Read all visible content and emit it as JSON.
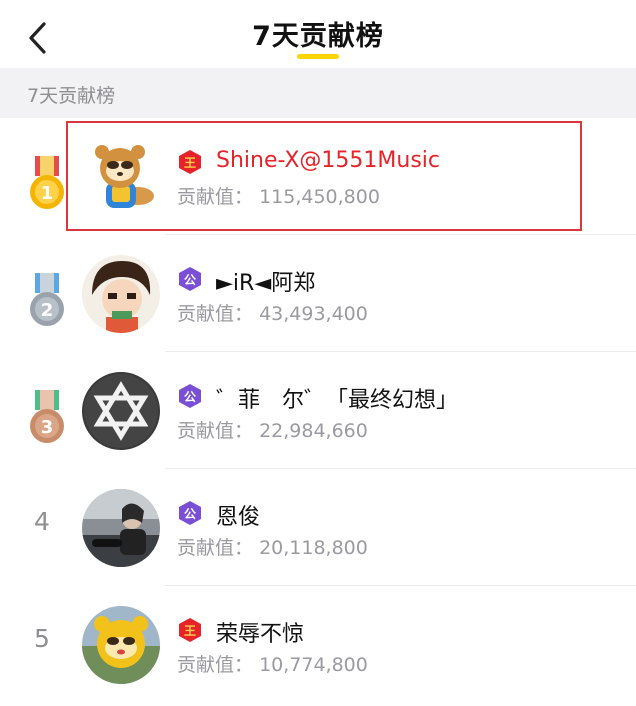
{
  "header": {
    "title": "7天贡献榜",
    "back_icon": "chevron-left-icon",
    "accent_color": "#ffd400"
  },
  "section": {
    "label": "7天贡献榜"
  },
  "list": {
    "value_prefix": "贡献值：",
    "items": [
      {
        "rank": "1",
        "badge": "王",
        "badge_color": "#e8222a",
        "name": "Shine-X@1551Music",
        "value": "115,450,800",
        "highlighted": true
      },
      {
        "rank": "2",
        "badge": "公",
        "badge_color": "#7a4fd6",
        "name": "►iR◄阿郑",
        "value": "43,493,400",
        "highlighted": false
      },
      {
        "rank": "3",
        "badge": "公",
        "badge_color": "#7a4fd6",
        "name": "゛菲　尔゛「最终幻想」",
        "value": "22,984,660",
        "highlighted": false
      },
      {
        "rank": "4",
        "badge": "公",
        "badge_color": "#7a4fd6",
        "name": "恩俊",
        "value": "20,118,800",
        "highlighted": false
      },
      {
        "rank": "5",
        "badge": "王",
        "badge_color": "#e8222a",
        "name": "荣辱不惊",
        "value": "10,774,800",
        "highlighted": false
      }
    ]
  },
  "colors": {
    "highlight_name": "#e8222a",
    "highlight_border": "#d9363e",
    "gold": "#f5b400",
    "silver": "#9aa3ad",
    "bronze": "#c98c6b"
  }
}
